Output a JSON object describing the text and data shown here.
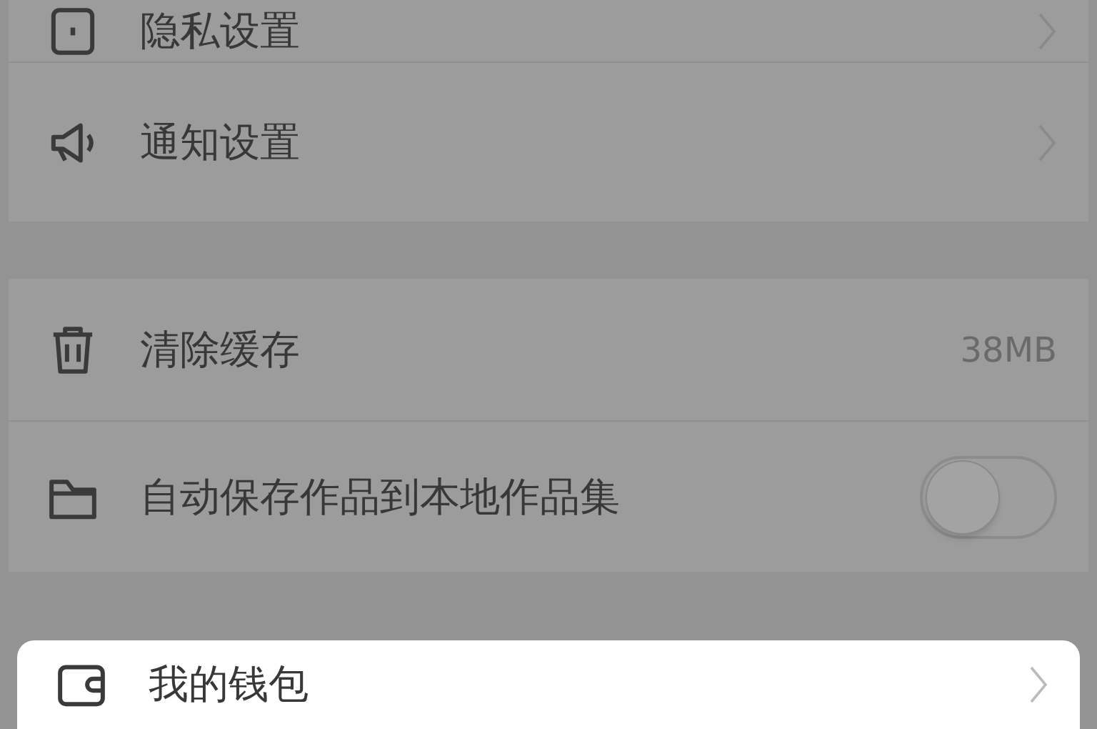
{
  "sections": [
    {
      "highlighted": false,
      "items": [
        {
          "kind": "nav",
          "label": "隐私设置"
        },
        {
          "kind": "nav",
          "label": "通知设置"
        }
      ]
    },
    {
      "highlighted": false,
      "items": [
        {
          "kind": "value",
          "label": "清除缓存",
          "value": "38MB"
        },
        {
          "kind": "toggle",
          "label": "自动保存作品到本地作品集",
          "on": false
        }
      ]
    },
    {
      "highlighted": true,
      "items": [
        {
          "kind": "nav",
          "label": "我的钱包"
        }
      ]
    }
  ]
}
